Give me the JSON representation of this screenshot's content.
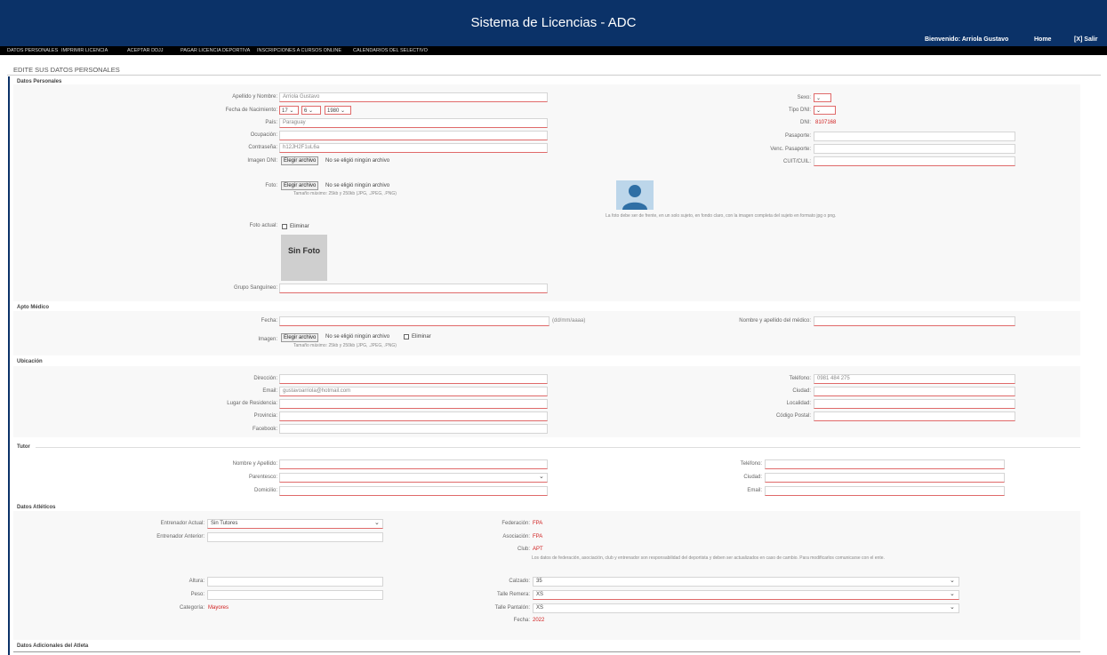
{
  "header": {
    "title": "Sistema de Licencias - ADC",
    "welcome": "Bienvenido: Arriola Gustavo",
    "home": "Home",
    "exit": "[X] Salir"
  },
  "nav": {
    "items": [
      "DATOS PERSONALES",
      "IMPRIMIR LICENCIA",
      "ACEPTAR DDJJ",
      "PAGAR LICENCIA DEPORTIVA",
      "INSCRIPCIONES A CURSOS ONLINE",
      "CALENDARIOS DEL SELECTIVO"
    ]
  },
  "page_title": "EDITE SUS DATOS PERSONALES",
  "personal": {
    "section": "Datos Personales",
    "lastname_label": "Apellido y Nombre:",
    "lastname_value": "Arriola Gustavo",
    "birth_label": "Fecha de Nacimiento:",
    "birth_day": "17",
    "birth_month": "6",
    "birth_year": "1980",
    "country_label": "País:",
    "country_value": "Paraguay",
    "job_label": "Ocupación:",
    "password_label": "Contraseña:",
    "password_value": "h12JH2F1uL6a",
    "image_label": "Imagen DNI:",
    "file_button": "Elegir archivo",
    "file_none": "No se eligió ningún archivo",
    "photo_label": "Foto:",
    "photo_hint": "Tamaño máximo: 25kb y 250kb (JPG, .JPEG, .PNG)",
    "avatar_caption": "La foto debe ser de frente, en un solo sujeto, en fondo claro, con la imagen completa del sujeto en formato jpg o png.",
    "current_photo_label": "Foto actual:",
    "delete_label": "Eliminar",
    "no_photo": "Sin Foto",
    "blood_label": "Grupo Sanguíneo:",
    "sex_label": "Sexo:",
    "doc_label": "Tipo DNI:",
    "dni_label": "DNI:",
    "dni_value": "8107168",
    "passport_label": "Pasaporte:",
    "passport_exp_label": "Venc. Pasaporte:",
    "cuit_label": "CUIT/CUIL:"
  },
  "medical": {
    "section": "Apto Médico",
    "date_label": "Fecha:",
    "date_hint": "(dd/mm/aaaa)",
    "doctor_label": "Nombre y apellido del médico:",
    "image_label": "Imagen:",
    "delete_label": "Eliminar",
    "hint": "Tamaño máximo: 25kb y 250kb (JPG, .JPEG, .PNG)"
  },
  "location": {
    "section": "Ubicación",
    "address_label": "Dirección:",
    "email_label": "Email:",
    "email_value": "gustavoarriola@hotmail.com",
    "residence_label": "Lugar de Residencia:",
    "province_label": "Provincia:",
    "facebook_label": "Facebook:",
    "phone_label": "Teléfono:",
    "phone_value": "0981 484 275",
    "city_label": "Ciudad:",
    "locality_label": "Localidad:",
    "postal_label": "Código Postal:"
  },
  "tutor": {
    "section": "Tutor",
    "name_label": "Nombre y Apellido:",
    "kinship_label": "Parentesco:",
    "address_label": "Domicilio:",
    "phone_label": "Teléfono:",
    "city_label": "Ciudad:",
    "email_label": "Email:"
  },
  "athlete": {
    "section": "Datos Atléticos",
    "school_label": "Entrenador Actual:",
    "school_value": "Sin Tutores",
    "prev_label": "Entrenador Anterior:",
    "federation_label": "Federación:",
    "federation_value": "FPA",
    "association_label": "Asociación:",
    "association_value": "FPA",
    "club_label": "Club:",
    "club_value": "APT",
    "notice": "Los datos de federación, asociación, club y entrenador son responsabilidad del deportista y deben ser actualizados en caso de cambio. Para modificarlos comunicarse con el ente.",
    "height_label": "Altura:",
    "weight_label": "Peso:",
    "category_label": "Categoría:",
    "category_value": "Mayores",
    "footwear_label": "Calzado:",
    "footwear_value": "35",
    "shirt_label": "Talle Remera:",
    "shirt_value": "XS",
    "pants_label": "Talle Pantalón:",
    "pants_value": "XS",
    "year_label": "Fecha:",
    "year_value": "2022"
  },
  "additional": {
    "section": "Datos Adicionales del Atleta"
  }
}
